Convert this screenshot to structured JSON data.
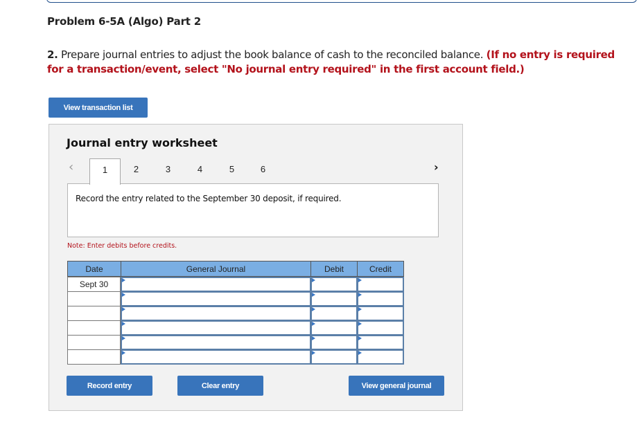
{
  "header": {
    "title": "Problem 6-5A (Algo) Part 2"
  },
  "instructions": {
    "number": "2.",
    "text": " Prepare journal entries to adjust the book balance of cash to the reconciled balance. ",
    "emphasis": "(If no entry is required for a transaction/event, select \"No journal entry required\" in the first account field.)"
  },
  "buttons": {
    "view_transaction_list": "View transaction list",
    "record_entry": "Record entry",
    "clear_entry": "Clear entry",
    "view_general_journal": "View general journal"
  },
  "worksheet": {
    "title": "Journal entry worksheet",
    "prev_icon": "chevron-left-icon",
    "next_icon": "chevron-right-icon",
    "prev_glyph": "‹",
    "next_glyph": "›",
    "tabs": [
      {
        "label": "1",
        "active": true
      },
      {
        "label": "2",
        "active": false
      },
      {
        "label": "3",
        "active": false
      },
      {
        "label": "4",
        "active": false
      },
      {
        "label": "5",
        "active": false
      },
      {
        "label": "6",
        "active": false
      }
    ],
    "question": "Record the entry related to the September 30 deposit, if required.",
    "note": "Note: Enter debits before credits."
  },
  "journal": {
    "headers": {
      "date": "Date",
      "general_journal": "General Journal",
      "debit": "Debit",
      "credit": "Credit"
    },
    "rows": [
      {
        "date": "Sept 30",
        "account": "",
        "debit": "",
        "credit": ""
      },
      {
        "date": "",
        "account": "",
        "debit": "",
        "credit": ""
      },
      {
        "date": "",
        "account": "",
        "debit": "",
        "credit": ""
      },
      {
        "date": "",
        "account": "",
        "debit": "",
        "credit": ""
      },
      {
        "date": "",
        "account": "",
        "debit": "",
        "credit": ""
      },
      {
        "date": "",
        "account": "",
        "debit": "",
        "credit": ""
      }
    ]
  },
  "colors": {
    "button_blue": "#3874bb",
    "header_blue": "#7aaee3",
    "input_border": "#5b7fa8",
    "alert_red": "#b3121b",
    "panel_bg": "#f2f2f2"
  }
}
